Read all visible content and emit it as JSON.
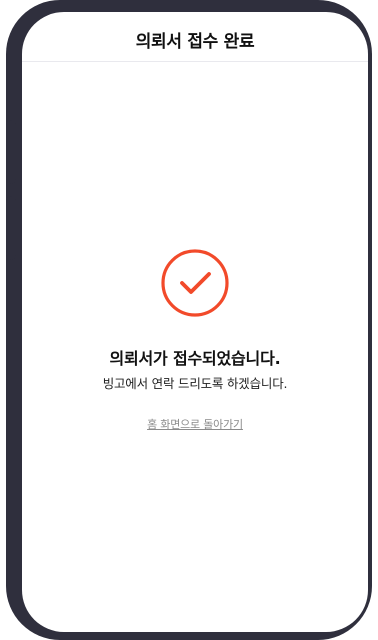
{
  "header": {
    "title": "의뢰서 접수 완료"
  },
  "success": {
    "title": "의뢰서가 접수되었습니다.",
    "message": "빙고에서 연락 드리도록 하겠습니다.",
    "home_link": "홈 화면으로 돌아가기"
  },
  "colors": {
    "accent": "#f24a2a",
    "frame": "#2f2f3d"
  },
  "icons": {
    "success": "check-circle-icon"
  }
}
